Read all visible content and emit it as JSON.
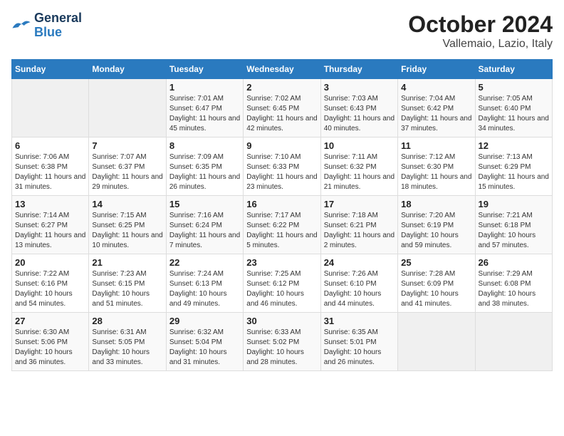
{
  "logo": {
    "line1": "General",
    "line2": "Blue"
  },
  "title": "October 2024",
  "subtitle": "Vallemaio, Lazio, Italy",
  "headers": [
    "Sunday",
    "Monday",
    "Tuesday",
    "Wednesday",
    "Thursday",
    "Friday",
    "Saturday"
  ],
  "weeks": [
    [
      {
        "day": "",
        "info": ""
      },
      {
        "day": "",
        "info": ""
      },
      {
        "day": "1",
        "info": "Sunrise: 7:01 AM\nSunset: 6:47 PM\nDaylight: 11 hours and 45 minutes."
      },
      {
        "day": "2",
        "info": "Sunrise: 7:02 AM\nSunset: 6:45 PM\nDaylight: 11 hours and 42 minutes."
      },
      {
        "day": "3",
        "info": "Sunrise: 7:03 AM\nSunset: 6:43 PM\nDaylight: 11 hours and 40 minutes."
      },
      {
        "day": "4",
        "info": "Sunrise: 7:04 AM\nSunset: 6:42 PM\nDaylight: 11 hours and 37 minutes."
      },
      {
        "day": "5",
        "info": "Sunrise: 7:05 AM\nSunset: 6:40 PM\nDaylight: 11 hours and 34 minutes."
      }
    ],
    [
      {
        "day": "6",
        "info": "Sunrise: 7:06 AM\nSunset: 6:38 PM\nDaylight: 11 hours and 31 minutes."
      },
      {
        "day": "7",
        "info": "Sunrise: 7:07 AM\nSunset: 6:37 PM\nDaylight: 11 hours and 29 minutes."
      },
      {
        "day": "8",
        "info": "Sunrise: 7:09 AM\nSunset: 6:35 PM\nDaylight: 11 hours and 26 minutes."
      },
      {
        "day": "9",
        "info": "Sunrise: 7:10 AM\nSunset: 6:33 PM\nDaylight: 11 hours and 23 minutes."
      },
      {
        "day": "10",
        "info": "Sunrise: 7:11 AM\nSunset: 6:32 PM\nDaylight: 11 hours and 21 minutes."
      },
      {
        "day": "11",
        "info": "Sunrise: 7:12 AM\nSunset: 6:30 PM\nDaylight: 11 hours and 18 minutes."
      },
      {
        "day": "12",
        "info": "Sunrise: 7:13 AM\nSunset: 6:29 PM\nDaylight: 11 hours and 15 minutes."
      }
    ],
    [
      {
        "day": "13",
        "info": "Sunrise: 7:14 AM\nSunset: 6:27 PM\nDaylight: 11 hours and 13 minutes."
      },
      {
        "day": "14",
        "info": "Sunrise: 7:15 AM\nSunset: 6:25 PM\nDaylight: 11 hours and 10 minutes."
      },
      {
        "day": "15",
        "info": "Sunrise: 7:16 AM\nSunset: 6:24 PM\nDaylight: 11 hours and 7 minutes."
      },
      {
        "day": "16",
        "info": "Sunrise: 7:17 AM\nSunset: 6:22 PM\nDaylight: 11 hours and 5 minutes."
      },
      {
        "day": "17",
        "info": "Sunrise: 7:18 AM\nSunset: 6:21 PM\nDaylight: 11 hours and 2 minutes."
      },
      {
        "day": "18",
        "info": "Sunrise: 7:20 AM\nSunset: 6:19 PM\nDaylight: 10 hours and 59 minutes."
      },
      {
        "day": "19",
        "info": "Sunrise: 7:21 AM\nSunset: 6:18 PM\nDaylight: 10 hours and 57 minutes."
      }
    ],
    [
      {
        "day": "20",
        "info": "Sunrise: 7:22 AM\nSunset: 6:16 PM\nDaylight: 10 hours and 54 minutes."
      },
      {
        "day": "21",
        "info": "Sunrise: 7:23 AM\nSunset: 6:15 PM\nDaylight: 10 hours and 51 minutes."
      },
      {
        "day": "22",
        "info": "Sunrise: 7:24 AM\nSunset: 6:13 PM\nDaylight: 10 hours and 49 minutes."
      },
      {
        "day": "23",
        "info": "Sunrise: 7:25 AM\nSunset: 6:12 PM\nDaylight: 10 hours and 46 minutes."
      },
      {
        "day": "24",
        "info": "Sunrise: 7:26 AM\nSunset: 6:10 PM\nDaylight: 10 hours and 44 minutes."
      },
      {
        "day": "25",
        "info": "Sunrise: 7:28 AM\nSunset: 6:09 PM\nDaylight: 10 hours and 41 minutes."
      },
      {
        "day": "26",
        "info": "Sunrise: 7:29 AM\nSunset: 6:08 PM\nDaylight: 10 hours and 38 minutes."
      }
    ],
    [
      {
        "day": "27",
        "info": "Sunrise: 6:30 AM\nSunset: 5:06 PM\nDaylight: 10 hours and 36 minutes."
      },
      {
        "day": "28",
        "info": "Sunrise: 6:31 AM\nSunset: 5:05 PM\nDaylight: 10 hours and 33 minutes."
      },
      {
        "day": "29",
        "info": "Sunrise: 6:32 AM\nSunset: 5:04 PM\nDaylight: 10 hours and 31 minutes."
      },
      {
        "day": "30",
        "info": "Sunrise: 6:33 AM\nSunset: 5:02 PM\nDaylight: 10 hours and 28 minutes."
      },
      {
        "day": "31",
        "info": "Sunrise: 6:35 AM\nSunset: 5:01 PM\nDaylight: 10 hours and 26 minutes."
      },
      {
        "day": "",
        "info": ""
      },
      {
        "day": "",
        "info": ""
      }
    ]
  ]
}
